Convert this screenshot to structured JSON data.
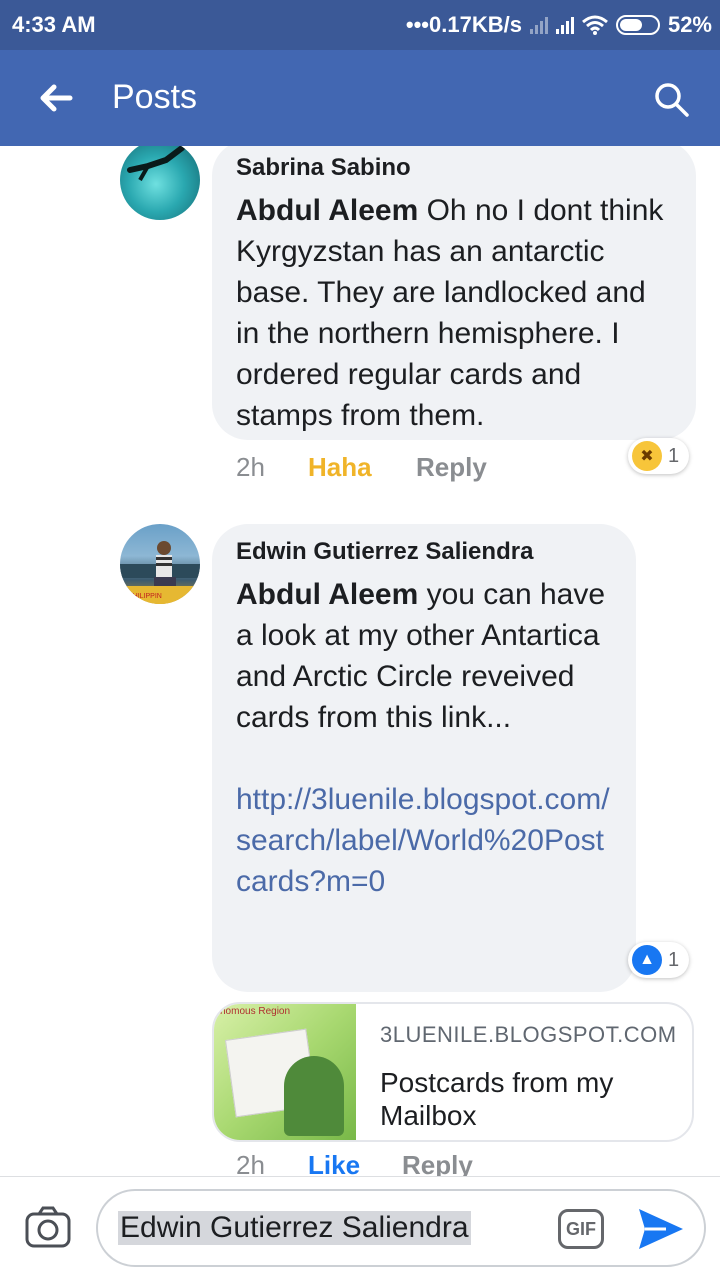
{
  "status_bar": {
    "time": "4:33 AM",
    "net_speed": "•••0.17KB/s",
    "battery": "52%"
  },
  "toolbar": {
    "title": "Posts",
    "back_icon": "back-arrow-icon",
    "search_icon": "search-icon"
  },
  "comments": [
    {
      "author": "Sabrina Sabino",
      "mention": "Abdul Aleem",
      "text": " Oh no I dont think Kyrgyzstan has an antarctic base. They are landlocked and in the northern hemisphere. I ordered regular cards and stamps from them.",
      "time": "2h",
      "reaction_label": "Haha",
      "reply_label": "Reply",
      "reaction_count": "1",
      "reaction_icon": "haha-emoji-icon"
    },
    {
      "author": "Edwin Gutierrez Saliendra",
      "mention": "Abdul Aleem",
      "text": " you can have a look at my other Antartica and Arctic Circle reveived cards from this link...",
      "link": "http://3luenile.blogspot.com/search/label/World%20Postcards?m=0",
      "time": "2h",
      "reaction_label": "Like",
      "reply_label": "Reply",
      "reaction_count": "1",
      "reaction_icon": "like-thumb-icon",
      "link_preview": {
        "domain": "3LUENILE.BLOGSPOT.COM",
        "title": "Postcards from my Mailbox",
        "thumb_text": "nomous Region"
      }
    }
  ],
  "composer": {
    "value": "Edwin Gutierrez Saliendra",
    "gif_label": "GIF",
    "camera_icon": "camera-icon",
    "send_icon": "send-icon"
  },
  "colors": {
    "status_bar": "#3b5997",
    "toolbar": "#4267b2",
    "bubble": "#f0f2f5",
    "link": "#4b6aa8",
    "haha": "#f0b429",
    "like": "#1877f2"
  }
}
